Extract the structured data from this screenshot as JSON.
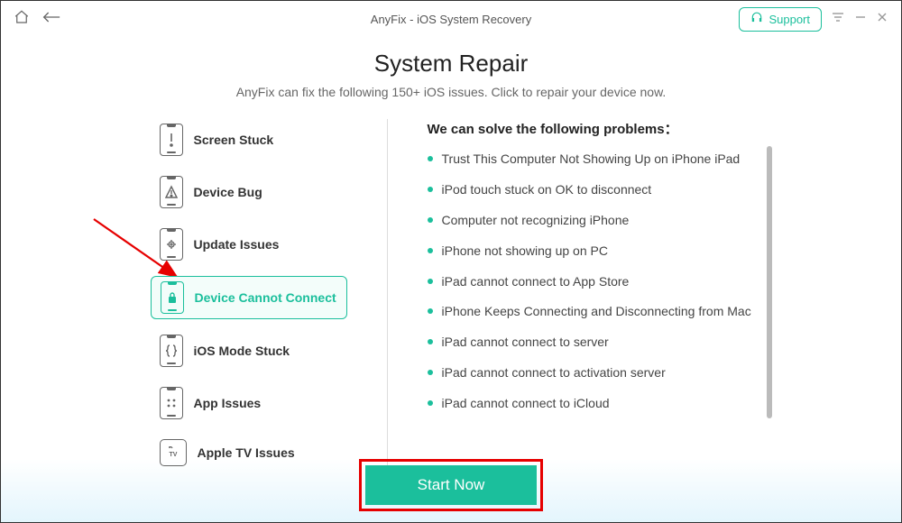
{
  "titlebar": {
    "title": "AnyFix - iOS System Recovery",
    "support_label": "Support"
  },
  "page": {
    "title": "System Repair",
    "subtitle": "AnyFix can fix the following 150+ iOS issues. Click to repair your device now."
  },
  "categories": [
    {
      "id": "screen-stuck",
      "label": "Screen Stuck",
      "icon": "exclaim"
    },
    {
      "id": "device-bug",
      "label": "Device Bug",
      "icon": "warning"
    },
    {
      "id": "update-issues",
      "label": "Update Issues",
      "icon": "gear"
    },
    {
      "id": "device-cannot-connect",
      "label": "Device Cannot Connect",
      "icon": "lock",
      "selected": true
    },
    {
      "id": "ios-mode-stuck",
      "label": "iOS Mode Stuck",
      "icon": "brace"
    },
    {
      "id": "app-issues",
      "label": "App Issues",
      "icon": "grid"
    },
    {
      "id": "apple-tv-issues",
      "label": "Apple TV Issues",
      "icon": "tv"
    }
  ],
  "problems": {
    "title": "We can solve the following problems：",
    "items": [
      "Trust This Computer Not Showing Up on iPhone iPad",
      "iPod touch stuck on OK to disconnect",
      "Computer not recognizing iPhone",
      "iPhone not showing up on PC",
      "iPad cannot connect to App Store",
      "iPhone Keeps Connecting and Disconnecting from Mac",
      "iPad cannot connect to server",
      "iPad cannot connect to activation server",
      "iPad cannot connect to iCloud"
    ]
  },
  "start_label": "Start Now",
  "colors": {
    "accent": "#1bbf9c",
    "highlight_border": "#e60000",
    "text": "#333"
  }
}
